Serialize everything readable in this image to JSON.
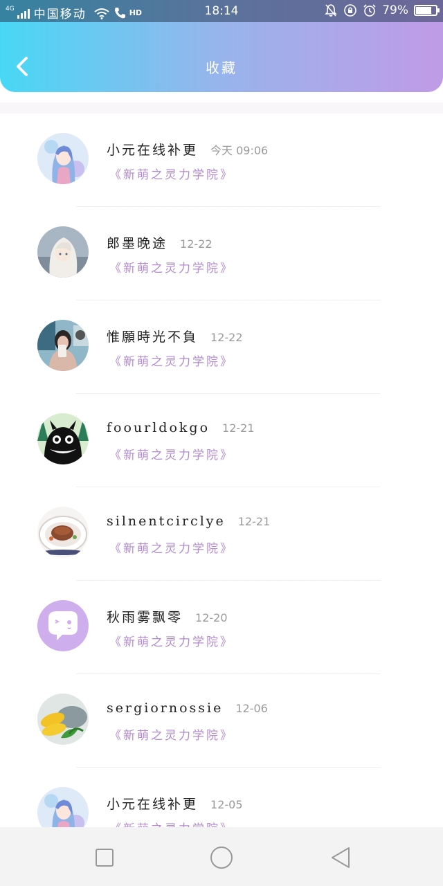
{
  "status_bar": {
    "network": "4G",
    "carrier": "中国移动",
    "hd_label": "HD",
    "time": "18:14",
    "battery_text": "79%",
    "battery_level": 0.79
  },
  "header": {
    "title": "收藏",
    "background_gradient": [
      "#48d8f5",
      "#98b4ec",
      "#c09be6"
    ]
  },
  "colors": {
    "book_title": "#b38ad0"
  },
  "favorites": [
    {
      "user": "小元在线补更",
      "date": "今天 09:06",
      "book": "《新萌之灵力学院》",
      "avatar": "anime-girl-blue"
    },
    {
      "user": "郎墨晚途",
      "date": "12-22",
      "book": "《新萌之灵力学院》",
      "avatar": "anime-girl-white-hair"
    },
    {
      "user": "惟願時光不負",
      "date": "12-22",
      "book": "《新萌之灵力学院》",
      "avatar": "selfie-girl"
    },
    {
      "user": "foourldokgo",
      "date": "12-21",
      "book": "《新萌之灵力学院》",
      "avatar": "totoro-forest"
    },
    {
      "user": "silnentcirclye",
      "date": "12-21",
      "book": "《新萌之灵力学院》",
      "avatar": "food-plate"
    },
    {
      "user": "秋雨雾飘零",
      "date": "12-20",
      "book": "《新萌之灵力学院》",
      "avatar": "default-chat-bubble"
    },
    {
      "user": "sergiornossie",
      "date": "12-06",
      "book": "《新萌之灵力学院》",
      "avatar": "corn-vegetables"
    },
    {
      "user": "小元在线补更",
      "date": "12-05",
      "book": "《新萌之灵力学院》",
      "avatar": "anime-girl-blue"
    }
  ],
  "nav": [
    "recent-apps-icon",
    "home-icon",
    "back-icon"
  ]
}
